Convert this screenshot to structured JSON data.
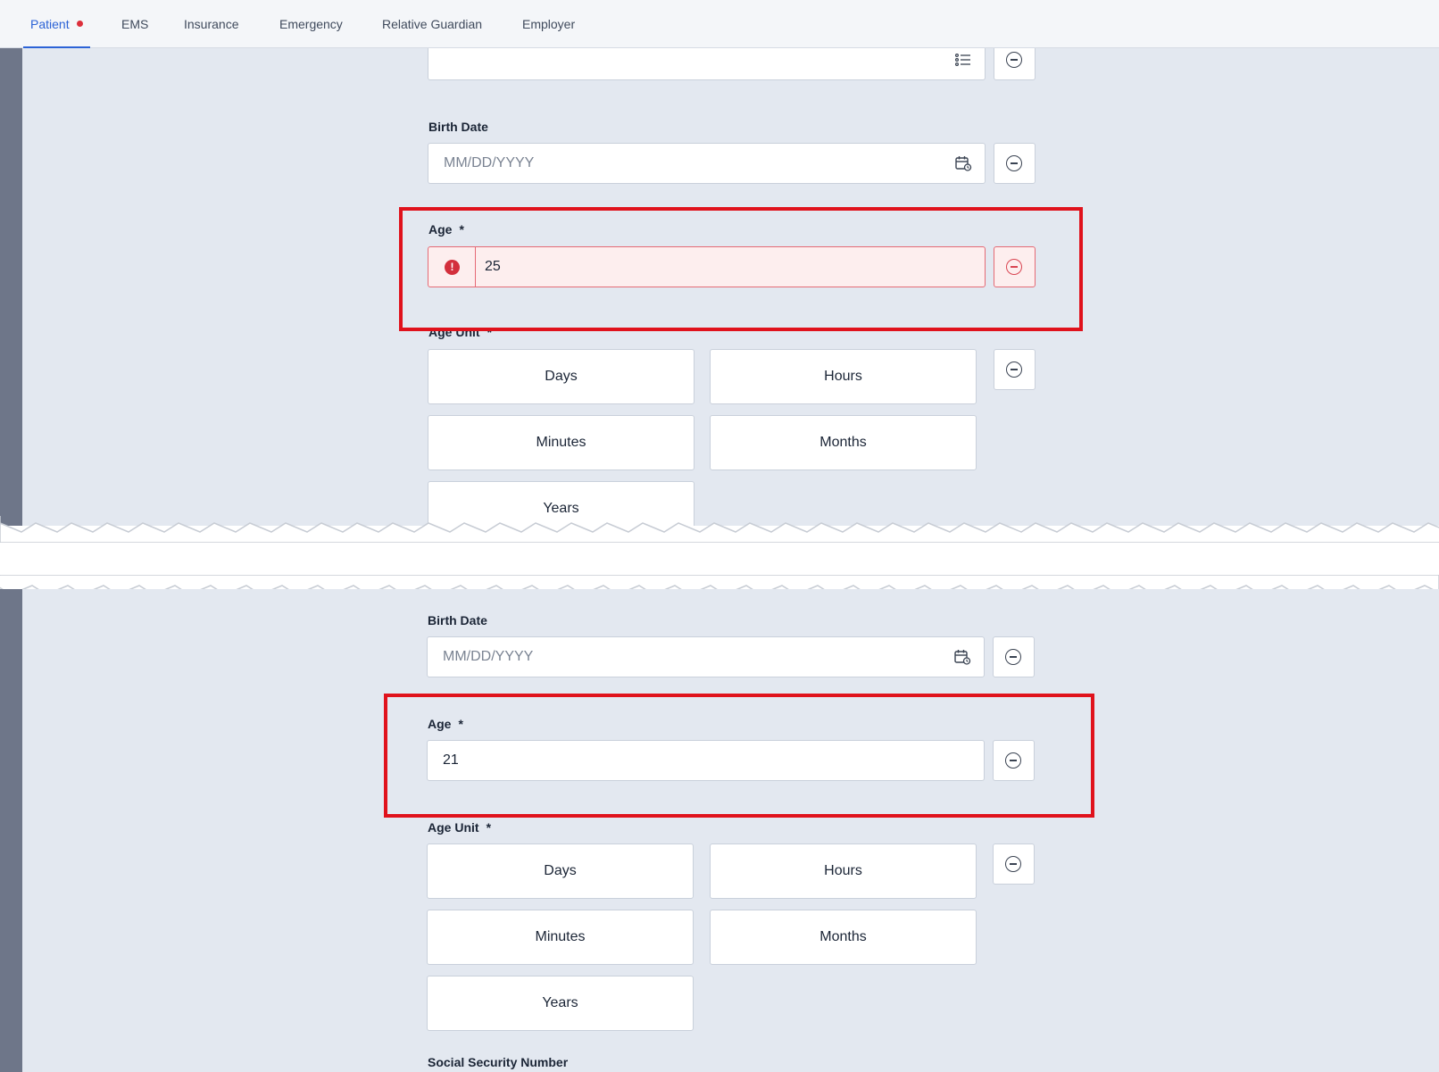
{
  "tabs": [
    {
      "label": "Patient",
      "active": true,
      "has_error_dot": true
    },
    {
      "label": "EMS"
    },
    {
      "label": "Insurance"
    },
    {
      "label": "Emergency"
    },
    {
      "label": "Relative Guardian"
    },
    {
      "label": "Employer"
    }
  ],
  "top": {
    "birth_date": {
      "label": "Birth Date",
      "placeholder": "MM/DD/YYYY"
    },
    "age": {
      "label": "Age",
      "required_mark": "*",
      "value": "25",
      "state": "error"
    },
    "age_unit": {
      "label": "Age Unit",
      "required_mark": "*",
      "options": [
        "Days",
        "Hours",
        "Minutes",
        "Months",
        "Years"
      ]
    }
  },
  "bottom": {
    "birth_date": {
      "label": "Birth Date",
      "placeholder": "MM/DD/YYYY"
    },
    "age": {
      "label": "Age",
      "required_mark": "*",
      "value": "21",
      "state": "valid"
    },
    "age_unit": {
      "label": "Age Unit",
      "required_mark": "*",
      "options": [
        "Days",
        "Hours",
        "Minutes",
        "Months",
        "Years"
      ]
    },
    "ssn": {
      "label": "Social Security Number"
    }
  },
  "colors": {
    "accent": "#2c63d6",
    "error": "#d32f3c",
    "highlight": "#e0121c",
    "panel_bg": "#e3e8f0"
  }
}
